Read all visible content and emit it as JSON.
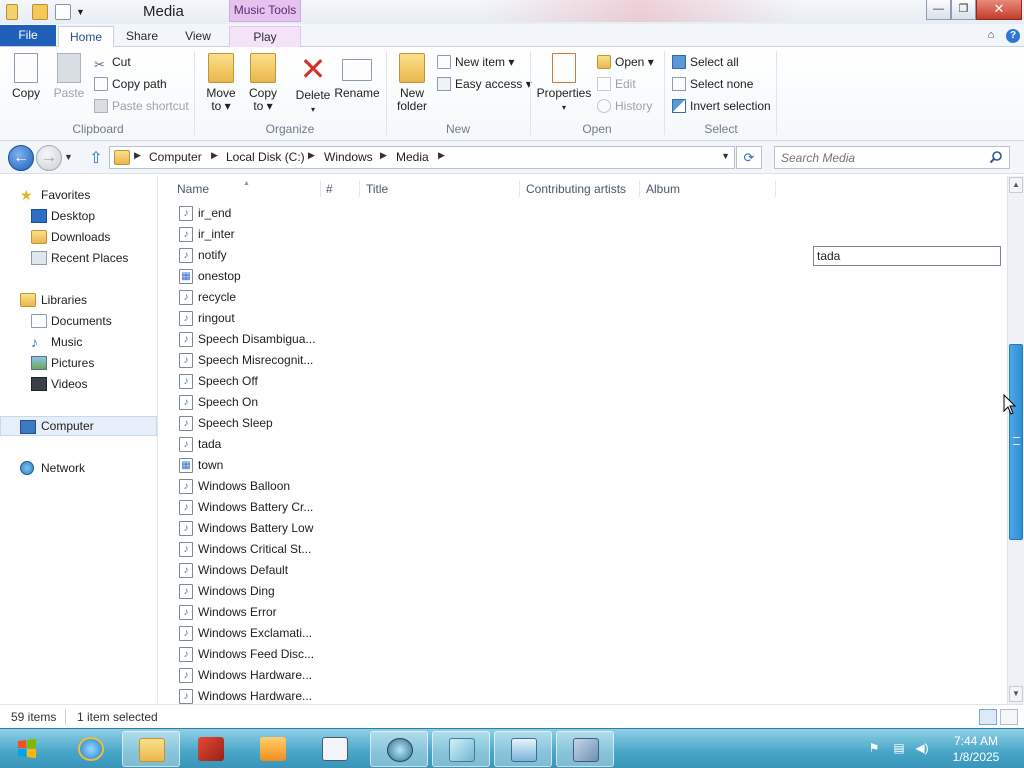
{
  "window": {
    "title": "Media",
    "contextual_tab": "Music Tools",
    "minimize": "—",
    "maximize": "❐",
    "close": "✕"
  },
  "ribbon_tabs": {
    "file": "File",
    "home": "Home",
    "share": "Share",
    "view": "View",
    "play": "Play"
  },
  "ribbon": {
    "clipboard": {
      "label": "Clipboard",
      "copy": "Copy",
      "paste": "Paste",
      "cut": "Cut",
      "copy_path": "Copy path",
      "paste_shortcut": "Paste shortcut"
    },
    "organize": {
      "label": "Organize",
      "move_to_1": "Move",
      "move_to_2": "to ▾",
      "copy_to_1": "Copy",
      "copy_to_2": "to ▾",
      "delete": "Delete",
      "rename": "Rename"
    },
    "new": {
      "label": "New",
      "new_folder_1": "New",
      "new_folder_2": "folder",
      "new_item": "New item ▾",
      "easy_access": "Easy access ▾"
    },
    "open": {
      "label": "Open",
      "properties": "Properties",
      "open": "Open ▾",
      "edit": "Edit",
      "history": "History"
    },
    "select": {
      "label": "Select",
      "select_all": "Select all",
      "select_none": "Select none",
      "invert": "Invert selection"
    }
  },
  "address": {
    "crumbs": [
      "Computer",
      "Local Disk (C:)",
      "Windows",
      "Media"
    ],
    "search_placeholder": "Search Media"
  },
  "navpane": {
    "favorites": "Favorites",
    "desktop": "Desktop",
    "downloads": "Downloads",
    "recent": "Recent Places",
    "libraries": "Libraries",
    "documents": "Documents",
    "music": "Music",
    "pictures": "Pictures",
    "videos": "Videos",
    "computer": "Computer",
    "network": "Network"
  },
  "columns": {
    "name": "Name",
    "number": "#",
    "title": "Title",
    "artists": "Contributing artists",
    "album": "Album"
  },
  "files": [
    {
      "name": "ir_end",
      "type": "audio"
    },
    {
      "name": "ir_inter",
      "type": "audio"
    },
    {
      "name": "notify",
      "type": "audio"
    },
    {
      "name": "onestop",
      "type": "midi"
    },
    {
      "name": "recycle",
      "type": "audio"
    },
    {
      "name": "ringout",
      "type": "audio"
    },
    {
      "name": "Speech Disambigua...",
      "type": "audio"
    },
    {
      "name": "Speech Misrecognit...",
      "type": "audio"
    },
    {
      "name": "Speech Off",
      "type": "audio"
    },
    {
      "name": "Speech On",
      "type": "audio"
    },
    {
      "name": "Speech Sleep",
      "type": "audio"
    },
    {
      "name": "tada",
      "type": "audio"
    },
    {
      "name": "town",
      "type": "midi"
    },
    {
      "name": "Windows Balloon",
      "type": "audio"
    },
    {
      "name": "Windows Battery Cr...",
      "type": "audio"
    },
    {
      "name": "Windows Battery Low",
      "type": "audio"
    },
    {
      "name": "Windows Critical St...",
      "type": "audio"
    },
    {
      "name": "Windows Default",
      "type": "audio"
    },
    {
      "name": "Windows Ding",
      "type": "audio"
    },
    {
      "name": "Windows Error",
      "type": "audio"
    },
    {
      "name": "Windows Exclamati...",
      "type": "audio"
    },
    {
      "name": "Windows Feed Disc...",
      "type": "audio"
    },
    {
      "name": "Windows Hardware...",
      "type": "audio"
    },
    {
      "name": "Windows Hardware...",
      "type": "audio"
    }
  ],
  "rename_value": "tada",
  "status": {
    "count": "59 items",
    "selected": "1 item selected"
  },
  "clock": {
    "time": "7:44 AM",
    "date": "1/8/2025"
  },
  "colors": {
    "accent": "#1f5fb8",
    "music_tools": "#e5c3ee",
    "taskbar": "#47a5c7",
    "scroll_thumb": "#2f8fd3"
  }
}
